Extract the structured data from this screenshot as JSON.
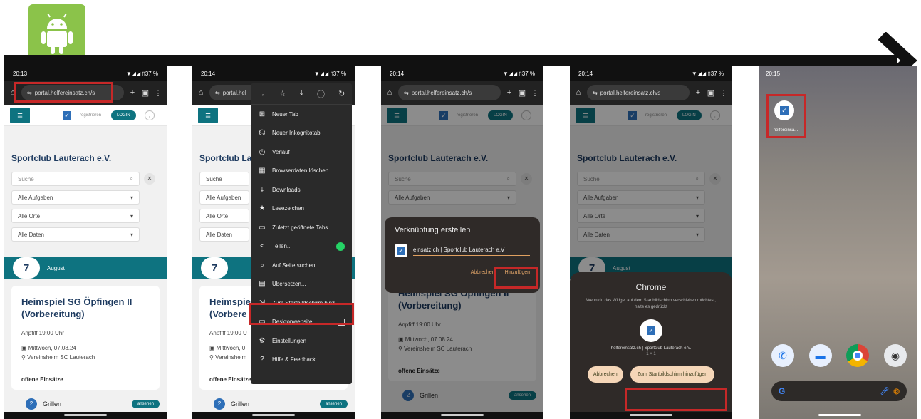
{
  "colors": {
    "teal": "#0e7380",
    "red_highlight": "#c62828",
    "android_green": "#8bc34a",
    "navy": "#1d3a5f"
  },
  "phone1": {
    "time": "20:13",
    "status_icons": "▼◢◢ ▯37 %",
    "url": "portal.helfereinsatz.ch/s",
    "register": "registrieren",
    "login": "LOGIN",
    "club": "Sportclub Lauterach e.V.",
    "search_placeholder": "Suche",
    "filters": [
      "Alle Aufgaben",
      "Alle Orte",
      "Alle Daten"
    ],
    "date_day": "7",
    "date_month": "August",
    "event_title": "Heimspiel SG Öpfingen II (Vorbereitung)",
    "kickoff": "Anpfiff 19:00 Uhr",
    "date_line": "Mittwoch, 07.08.24",
    "venue": "Vereinsheim SC Lauterach",
    "open_jobs": "offene Einsätze",
    "job_num": "2",
    "job_name": "Grillen",
    "view": "ansehen"
  },
  "phone2": {
    "time": "20:14",
    "url": "portal.hel",
    "club": "Sportclub Lau",
    "search": "Suche",
    "filters": [
      "Alle Aufgaben",
      "Alle Orte",
      "Alle Daten"
    ],
    "event_title": "Heimspiel (Vorbere",
    "kickoff": "Anpfiff 19:00 U",
    "date_line": "Mittwoch, 0",
    "venue": "Vereinsheim",
    "open_jobs": "offene Einsätze",
    "job_name": "Grillen",
    "view": "ansehen",
    "menu": [
      {
        "icon": "⊞",
        "name": "new-tab-icon",
        "label": "Neuer Tab"
      },
      {
        "icon": "☊",
        "name": "incognito-icon",
        "label": "Neuer Inkognitotab"
      },
      {
        "icon": "◷",
        "name": "history-icon",
        "label": "Verlauf"
      },
      {
        "icon": "▦",
        "name": "trash-icon",
        "label": "Browserdaten löschen"
      },
      {
        "icon": "⤓",
        "name": "download-icon",
        "label": "Downloads"
      },
      {
        "icon": "★",
        "name": "star-icon",
        "label": "Lesezeichen"
      },
      {
        "icon": "▭",
        "name": "recent-tabs-icon",
        "label": "Zuletzt geöffnete Tabs"
      },
      {
        "icon": "<",
        "name": "share-icon",
        "label": "Teilen..."
      },
      {
        "icon": "⌕",
        "name": "find-icon",
        "label": "Auf Seite suchen"
      },
      {
        "icon": "▤",
        "name": "translate-icon",
        "label": "Übersetzen..."
      },
      {
        "icon": "⇲",
        "name": "add-home-icon",
        "label": "Zum Startbildschirm hinz..."
      },
      {
        "icon": "▭",
        "name": "desktop-icon",
        "label": "Desktopwebsite"
      },
      {
        "icon": "⚙",
        "name": "settings-icon",
        "label": "Einstellungen"
      },
      {
        "icon": "?",
        "name": "help-icon",
        "label": "Hilfe & Feedback"
      }
    ]
  },
  "phone3": {
    "time": "20:14",
    "url": "portal.helfereinsatz.ch/s",
    "club": "Sportclub Lauterach e.V.",
    "dialog_title": "Verknüpfung erstellen",
    "dialog_value": "einsatz.ch | Sportclub Lauterach e.V",
    "cancel": "Abbrechen",
    "add": "Hinzufügen",
    "event_title": "Heimspiel SG Öpfingen II (Vorbereitung)",
    "kickoff": "Anpfiff 19:00 Uhr",
    "date_line": "Mittwoch, 07.08.24",
    "venue": "Vereinsheim SC Lauterach",
    "open_jobs": "offene Einsätze",
    "job_name": "Grillen",
    "view": "ansehen",
    "search": "Suche",
    "filter1": "Alle Aufgaben"
  },
  "phone4": {
    "time": "20:14",
    "url": "portal.helfereinsatz.ch/s",
    "club": "Sportclub Lauterach e.V.",
    "search": "Suche",
    "filters": [
      "Alle Aufgaben",
      "Alle Orte",
      "Alle Daten"
    ],
    "date_day": "7",
    "date_month": "August",
    "sheet_title": "Chrome",
    "sheet_desc": "Wenn du das Widget auf dem Startbildschirm verschieben möchtest, halte es gedrückt",
    "widget_name": "helfereinsatz.ch | Sportclub Lauterach e.V.",
    "widget_size": "1 × 1",
    "cancel": "Abbrechen",
    "add": "Zum Startbildschirm hinzufügen"
  },
  "phone5": {
    "time": "20:15",
    "app_label": "helfereinsa..."
  }
}
